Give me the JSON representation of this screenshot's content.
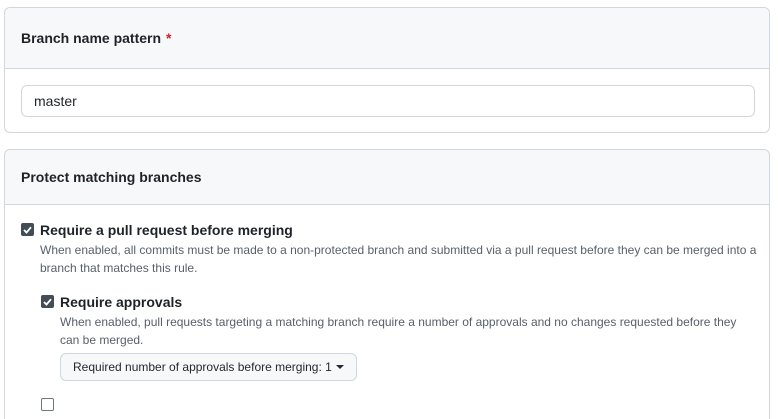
{
  "branch_section": {
    "title": "Branch name pattern",
    "required_mark": "*",
    "input_value": "master"
  },
  "protect_section": {
    "title": "Protect matching branches",
    "options": [
      {
        "label": "Require a pull request before merging",
        "checked": true,
        "description": "When enabled, all commits must be made to a non-protected branch and submitted via a pull request before they can be merged into a branch that matches this rule."
      },
      {
        "label": "Require approvals",
        "checked": true,
        "description": "When enabled, pull requests targeting a matching branch require a number of approvals and no changes requested before they can be merged."
      }
    ],
    "approvals_dropdown": {
      "label": "Required number of approvals before merging: 1"
    }
  }
}
